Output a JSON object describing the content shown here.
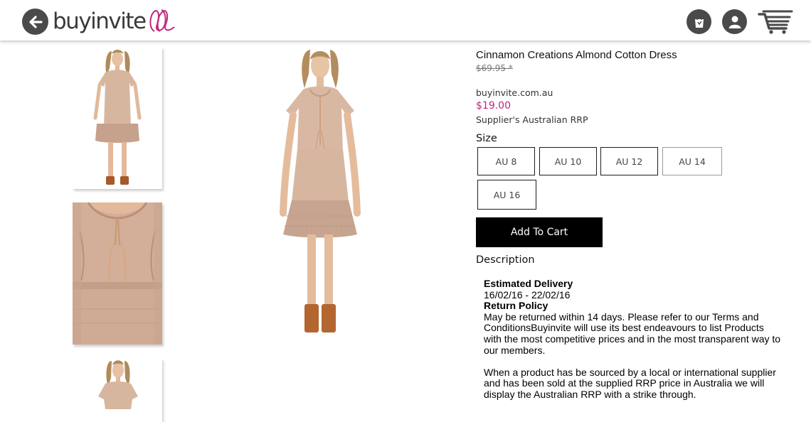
{
  "header": {
    "logo_text": "buyinvite",
    "icons": {
      "back": "back-arrow-icon",
      "bag": "shopping-bag-icon",
      "account": "account-icon",
      "cart": "cart-icon"
    },
    "accent_color": "#c2267d"
  },
  "product": {
    "title": "Cinnamon Creations Almond Cotton Dress",
    "old_price": "$69.95 *",
    "site": "buyinvite.com.au",
    "price": "$19.00",
    "rrp_note": "Supplier's Australian RRP",
    "size_label": "Size",
    "sizes": [
      "AU 8",
      "AU 10",
      "AU 12",
      "AU 14",
      "AU 16"
    ],
    "add_to_cart": "Add To Cart",
    "description_label": "Description"
  },
  "description": {
    "delivery_heading": "Estimated Delivery",
    "delivery_dates": "16/02/16 - 22/02/16",
    "return_heading": "Return Policy",
    "return_text": "May be returned within 14 days. Please refer to our Terms and ConditionsBuyinvite will use its best endeavours to list Products with the most competitive prices and in the most transparent way to our members.",
    "rrp_text": "When a product has be sourced by a local or international supplier and has been sold at the supplied RRP price in Australia we will display the Australian RRP with a strike through."
  }
}
